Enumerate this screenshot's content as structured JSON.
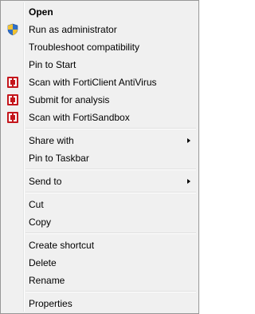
{
  "menu": {
    "items": [
      {
        "label": "Open"
      },
      {
        "label": "Run as administrator",
        "icon": "uac-shield-icon"
      },
      {
        "label": "Troubleshoot compatibility"
      },
      {
        "label": "Pin to Start"
      },
      {
        "label": "Scan with FortiClient AntiVirus",
        "icon": "forticlient-icon"
      },
      {
        "label": "Submit for analysis",
        "icon": "forticlient-icon"
      },
      {
        "label": "Scan with FortiSandbox",
        "icon": "forticlient-icon"
      },
      {
        "label": "Share with",
        "submenu": true
      },
      {
        "label": "Pin to Taskbar"
      },
      {
        "label": "Send to",
        "submenu": true
      },
      {
        "label": "Cut"
      },
      {
        "label": "Copy"
      },
      {
        "label": "Create shortcut"
      },
      {
        "label": "Delete"
      },
      {
        "label": "Rename"
      },
      {
        "label": "Properties"
      }
    ]
  },
  "colors": {
    "menu_background": "#f0f0f0",
    "forti_red": "#c4161c",
    "shield_blue": "#2f6fc8",
    "shield_yellow": "#f2c232"
  }
}
